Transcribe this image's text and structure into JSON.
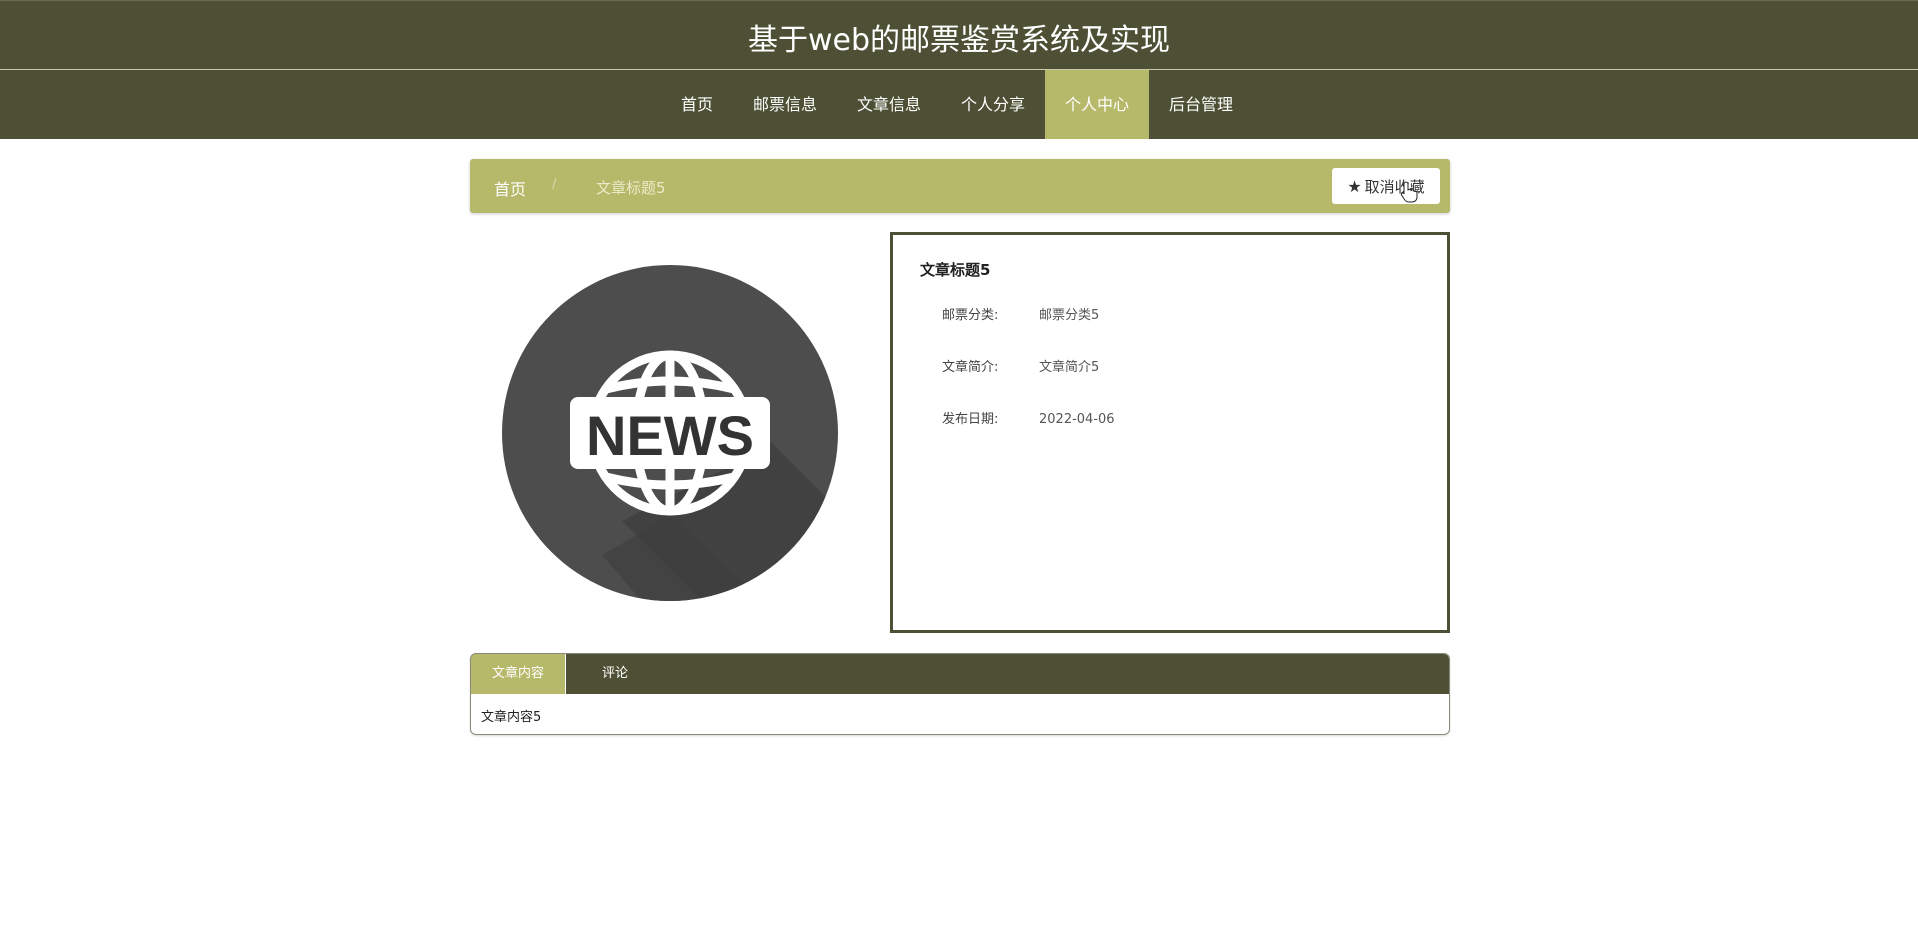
{
  "header": {
    "title": "基于web的邮票鉴赏系统及实现"
  },
  "nav": {
    "items": [
      {
        "label": "首页"
      },
      {
        "label": "邮票信息"
      },
      {
        "label": "文章信息"
      },
      {
        "label": "个人分享"
      },
      {
        "label": "个人中心",
        "active": true
      },
      {
        "label": "后台管理"
      }
    ]
  },
  "breadcrumb": {
    "home": "首页",
    "separator": "/",
    "current": "文章标题5"
  },
  "actions": {
    "unfavorite_label": "取消收藏",
    "unfavorite_icon": "star-icon"
  },
  "image": {
    "text": "NEWS",
    "icon": "news-globe-icon"
  },
  "detail": {
    "title": "文章标题5",
    "fields": [
      {
        "label": "邮票分类:",
        "value": "邮票分类5"
      },
      {
        "label": "文章简介:",
        "value": "文章简介5"
      },
      {
        "label": "发布日期:",
        "value": "2022-04-06"
      }
    ]
  },
  "tabs": {
    "items": [
      {
        "label": "文章内容",
        "active": true
      },
      {
        "label": "评论"
      }
    ],
    "content": "文章内容5"
  },
  "colors": {
    "header_bg": "#4e5035",
    "accent": "#b6b96a"
  }
}
